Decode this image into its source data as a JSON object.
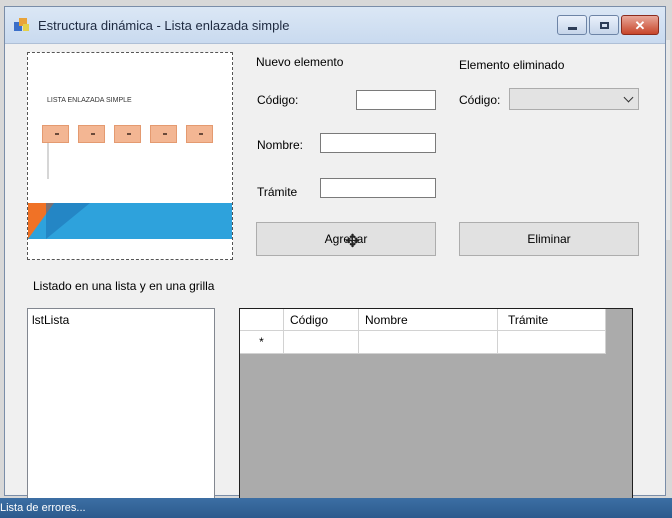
{
  "window": {
    "title": "Estructura dinámica - Lista enlazada simple",
    "minimize_icon": "minimize-icon",
    "maximize_icon": "maximize-icon",
    "close_icon": "close-icon",
    "close_glyph": "✕"
  },
  "picture": {
    "slide_title": "LISTA ENLAZADA SIMPLE",
    "node_count": 5,
    "colors": {
      "node": "#f3b693",
      "band": "#2ea2dc",
      "accent": "#f07226"
    }
  },
  "nuevo": {
    "header": "Nuevo elemento",
    "codigo_label": "Código:",
    "nombre_label": "Nombre:",
    "tramite_label": "Trámite",
    "codigo_value": "",
    "nombre_value": "",
    "tramite_value": "",
    "add_button": "Agregar"
  },
  "eliminado": {
    "header": "Elemento eliminado",
    "codigo_label": "Código:",
    "codigo_selected": "",
    "delete_button": "Eliminar"
  },
  "listado": {
    "header": "Listado en una lista y en una grilla",
    "listbox_item": "lstLista"
  },
  "grid": {
    "columns": [
      "Código",
      "Nombre",
      "Trámite"
    ],
    "new_row_marker": "*",
    "rows": [
      [
        "",
        "",
        ""
      ]
    ]
  },
  "taskbar": {
    "text": "Lista de errores..."
  },
  "cursor": {
    "icon": "move-cursor-icon",
    "glyph": "✥"
  }
}
